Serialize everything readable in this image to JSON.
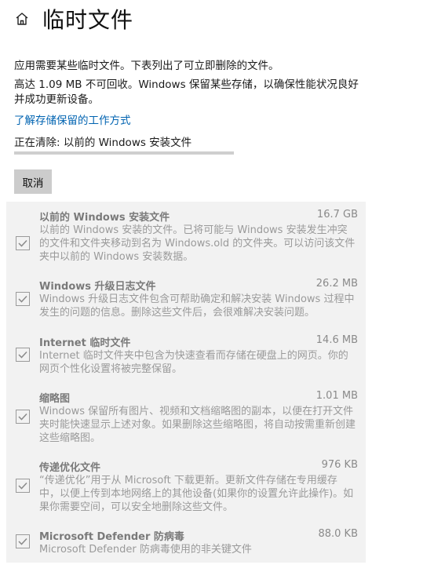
{
  "header": {
    "title": "临时文件",
    "home_icon": "home-icon"
  },
  "intro": {
    "description": "应用需要某些临时文件。下表列出了可立即删除的文件。",
    "reserved_note": "高达 1.09 MB 不可回收。Windows 保留某些存储，以确保性能状况良好并成功更新设备。",
    "learn_link": "了解存储保留的工作方式"
  },
  "status": {
    "text": "正在清除: 以前的 Windows 安装文件",
    "progress_fraction": 1.0
  },
  "actions": {
    "cancel_label": "取消"
  },
  "items": [
    {
      "title": "以前的 Windows 安装文件",
      "size": "16.7 GB",
      "description": "以前的 Windows 安装的文件。已将可能与 Windows 安装发生冲突的文件和文件夹移动到名为 Windows.old 的文件夹。可以访问该文件夹中以前的 Windows 安装数据。",
      "checked": true
    },
    {
      "title": "Windows 升级日志文件",
      "size": "26.2 MB",
      "description": "Windows 升级日志文件包含可帮助确定和解决安装 Windows 过程中发生的问题的信息。删除这些文件后，会很难解决安装问题。",
      "checked": true
    },
    {
      "title": "Internet 临时文件",
      "size": "14.6 MB",
      "description": "Internet 临时文件夹中包含为快速查看而存储在硬盘上的网页。你的网页个性化设置将被完整保留。",
      "checked": true
    },
    {
      "title": "缩略图",
      "size": "1.01 MB",
      "description": "Windows 保留所有图片、视频和文档缩略图的副本，以便在打开文件夹时能快速显示上述对象。如果删除这些缩略图，将自动按需重新创建这些缩略图。",
      "checked": true
    },
    {
      "title": "传递优化文件",
      "size": "976 KB",
      "description": "“传递优化”用于从 Microsoft 下载更新。更新文件存储在专用缓存中，以便上传到本地网络上的其他设备(如果你的设置允许此操作)。如果你需要空间，可以安全地删除这些文件。",
      "checked": true
    },
    {
      "title": "Microsoft Defender 防病毒",
      "size": "88.0 KB",
      "description": "Microsoft Defender 防病毒使用的非关键文件",
      "checked": true
    }
  ]
}
